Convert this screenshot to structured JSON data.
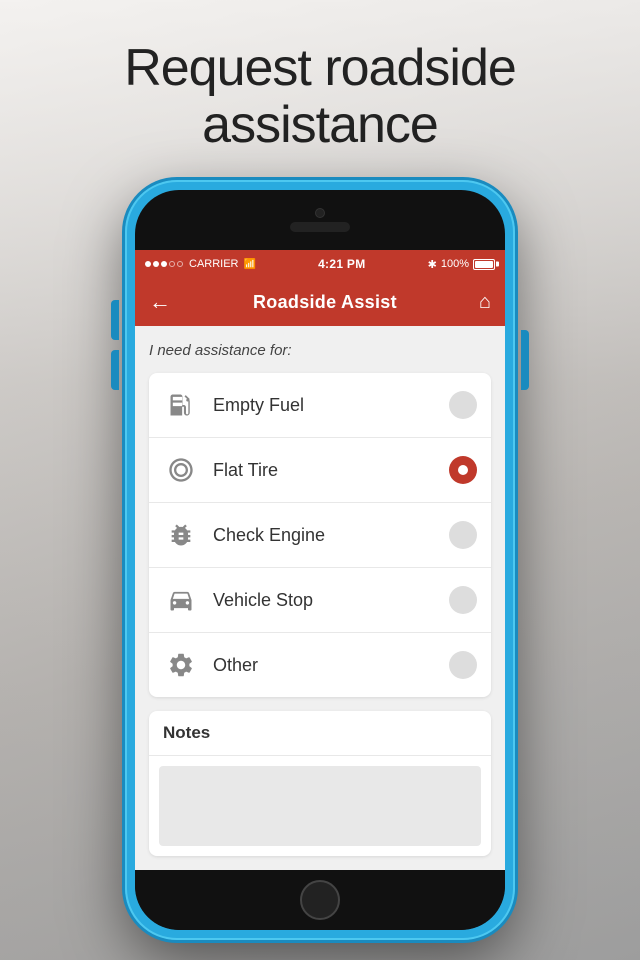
{
  "page": {
    "title_line1": "Request roadside",
    "title_line2": "assistance"
  },
  "status_bar": {
    "dots": [
      "filled",
      "filled",
      "filled",
      "empty",
      "empty"
    ],
    "carrier": "CARRIER",
    "time": "4:21 PM",
    "bluetooth": "B",
    "battery_percent": "100%"
  },
  "nav": {
    "back_label": "←",
    "title": "Roadside Assist",
    "home_label": "⌂"
  },
  "screen": {
    "assistance_label": "I need assistance for:",
    "options": [
      {
        "id": "empty-fuel",
        "label": "Empty Fuel",
        "icon": "fuel",
        "selected": false
      },
      {
        "id": "flat-tire",
        "label": "Flat Tire",
        "icon": "tire",
        "selected": true
      },
      {
        "id": "check-engine",
        "label": "Check Engine",
        "icon": "engine",
        "selected": false
      },
      {
        "id": "vehicle-stop",
        "label": "Vehicle Stop",
        "icon": "car",
        "selected": false
      },
      {
        "id": "other",
        "label": "Other",
        "icon": "gear",
        "selected": false
      }
    ],
    "notes_label": "Notes"
  }
}
